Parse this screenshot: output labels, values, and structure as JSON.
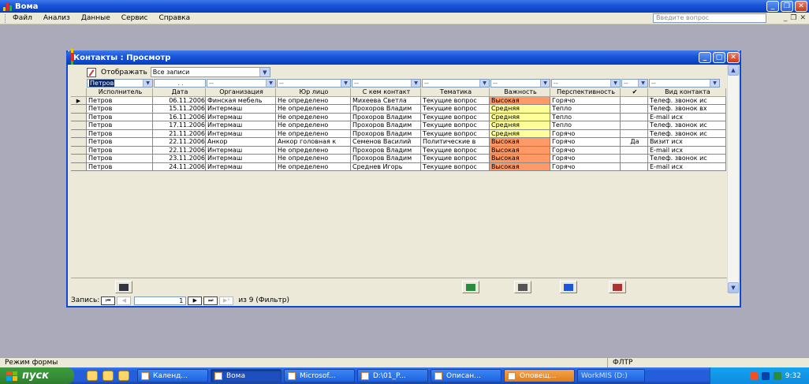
{
  "app": {
    "title": "Bома"
  },
  "menu": {
    "items": [
      "Файл",
      "Анализ",
      "Данные",
      "Сервис",
      "Справка"
    ],
    "question_placeholder": "Введите вопрос"
  },
  "child": {
    "title": "Контакты : Просмотр",
    "display_label": "Отображать",
    "display_value": "Все записи"
  },
  "filters": {
    "executor": "Петров",
    "date": ". .",
    "others": [
      "--",
      "--",
      "--",
      "--",
      "--",
      "--",
      "--",
      "--"
    ]
  },
  "grid": {
    "headers": [
      "Исполнитель",
      "Дата",
      "Организация",
      "Юр лицо",
      "С кем контакт",
      "Тематика",
      "Важность",
      "Перспективность",
      "✔",
      "Вид контакта"
    ],
    "rows": [
      [
        "Петров",
        "06.11.2006",
        "Финская мебель",
        "Не определено",
        "Михеева Светла",
        "Текущие вопрос",
        "Высокая",
        "Горячо",
        "",
        "Телеф. звонок ис"
      ],
      [
        "Петров",
        "15.11.2006",
        "Интермаш",
        "Не определено",
        "Прохоров Владим",
        "Текущие вопрос",
        "Средняя",
        "Тепло",
        "",
        "Телеф. звонок вх"
      ],
      [
        "Петров",
        "16.11.2006",
        "Интермаш",
        "Не определено",
        "Прохоров Владим",
        "Текущие вопрос",
        "Средняя",
        "Тепло",
        "",
        "E-mail исх"
      ],
      [
        "Петров",
        "17.11.2006",
        "Интермаш",
        "Не определено",
        "Прохоров Владим",
        "Текущие вопрос",
        "Средняя",
        "Тепло",
        "",
        "Телеф. звонок ис"
      ],
      [
        "Петров",
        "21.11.2006",
        "Интермаш",
        "Не определено",
        "Прохоров Владим",
        "Текущие вопрос",
        "Средняя",
        "Горячо",
        "",
        "Телеф. звонок ис"
      ],
      [
        "Петров",
        "22.11.2006",
        "Анкор",
        "Анкор головная к",
        "Семенов Василий",
        "Политические в",
        "Высокая",
        "Горячо",
        "Да",
        "Визит исх"
      ],
      [
        "Петров",
        "22.11.2006",
        "Интермаш",
        "Не определено",
        "Прохоров Владим",
        "Текущие вопрос",
        "Высокая",
        "Горячо",
        "",
        "E-mail исх"
      ],
      [
        "Петров",
        "23.11.2006",
        "Интермаш",
        "Не определено",
        "Прохоров Владим",
        "Текущие вопрос",
        "Высокая",
        "Горячо",
        "",
        "Телеф. звонок ис"
      ],
      [
        "Петров",
        "24.11.2006",
        "Интермаш",
        "Не определено",
        "Среднев Игорь",
        "Текущие вопрос",
        "Высокая",
        "Горячо",
        "",
        "E-mail исх"
      ]
    ]
  },
  "nav": {
    "record_label": "Запись:",
    "current": "1",
    "total_text": "из  9 (Фильтр)"
  },
  "status": {
    "mode": "Режим формы",
    "filter": "ФЛТР"
  },
  "taskbar": {
    "start": "пуск",
    "tasks": [
      "Календ...",
      "Bома",
      "Microsof...",
      "D:\\01_P...",
      "Описан...",
      "Оповещ...",
      "WorkMIS (D:)"
    ],
    "clock": "9:32"
  }
}
